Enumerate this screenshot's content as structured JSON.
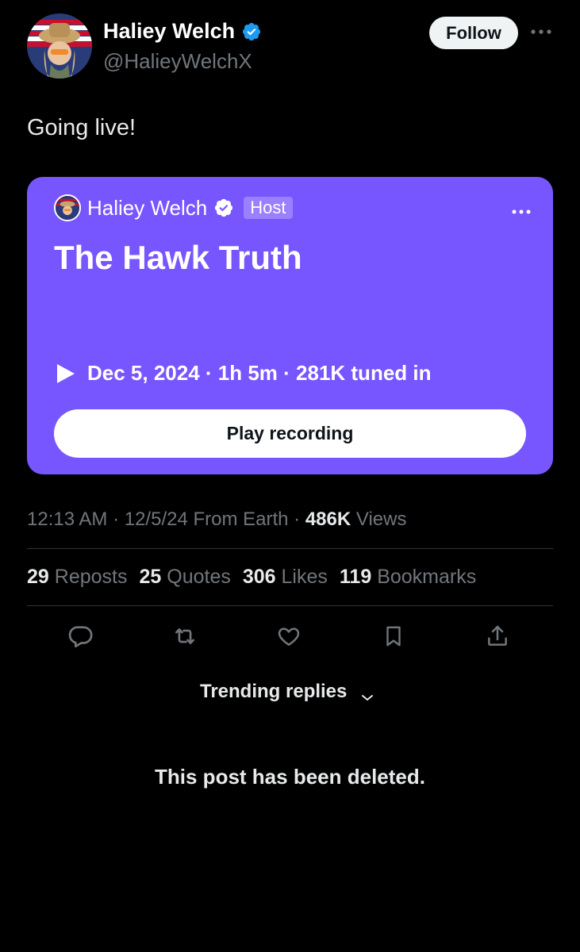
{
  "author": {
    "display_name": "Haliey Welch",
    "handle": "@HalieyWelchX",
    "avatar_icon": "avatar-flag-hat",
    "verified_color": "#1d9bf0"
  },
  "follow_label": "Follow",
  "post": {
    "text": "Going live!"
  },
  "space": {
    "host_name": "Haliey Welch",
    "host_badge": "Host",
    "title": "The Hawk Truth",
    "meta": "Dec 5, 2024 · 1h 5m · 281K tuned in",
    "play_label": "Play recording",
    "card_color": "#7856ff"
  },
  "timestamp": {
    "prefix": "12:13 AM · 12/5/24 From Earth · ",
    "views_count": "486K",
    "views_label": " Views"
  },
  "stats": [
    {
      "num": "29",
      "label": "Reposts"
    },
    {
      "num": "25",
      "label": "Quotes"
    },
    {
      "num": "306",
      "label": "Likes"
    },
    {
      "num": "119",
      "label": "Bookmarks"
    }
  ],
  "actions": [
    "reply-icon",
    "repost-icon",
    "like-icon",
    "bookmark-icon",
    "share-icon"
  ],
  "replies": {
    "sort_label": "Trending replies",
    "deleted_notice": "This post has been deleted."
  }
}
